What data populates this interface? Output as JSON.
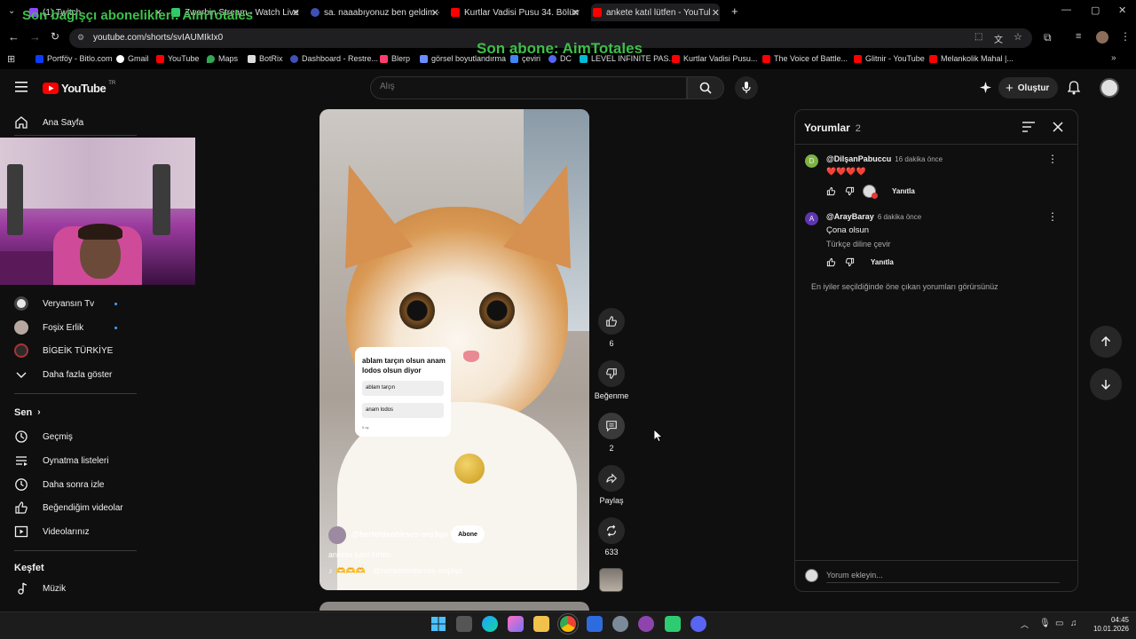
{
  "browser": {
    "tabs": [
      {
        "title": "(1) Twitch",
        "color": "#9146ff"
      },
      {
        "title": "Zwerbin Stream - Watch Live o",
        "color": "#2ecc71"
      },
      {
        "title": "sa. naaabıyonuz ben geldim - R",
        "color": "#3f51b5"
      },
      {
        "title": "Kurtlar Vadisi Pusu 34. Bölüm F",
        "color": "#ff0000"
      },
      {
        "title": "ankete katıl lütfen - YouTul",
        "color": "#ff0000"
      }
    ],
    "url": "youtube.com/shorts/svIAUMIkIx0",
    "bookmarks": [
      "Portföy - Bitlo.com",
      "Gmail",
      "YouTube",
      "Maps",
      "BotRix",
      "Dashboard - Restre...",
      "Blerp",
      "görsel boyutlandırma",
      "çeviri",
      "DC",
      "LEVEL INFINITE PAS...",
      "Kurtlar Vadisi Pusu...",
      "The Voice of Battle...",
      "Glitnir - YouTube",
      "Melankolik Mahal |..."
    ]
  },
  "overlays": {
    "donor_text": "Son bağışçı abonelikleri: AimTotales",
    "subscriber_text": "Son abone: AimTotales"
  },
  "header": {
    "logo_text": "YouTube",
    "logo_country": "TR",
    "search_placeholder": "Alış",
    "create_label": "Oluştur"
  },
  "sidebar": {
    "home_label": "Ana Sayfa",
    "subs": [
      {
        "label": "Veryansın Tv",
        "new": true
      },
      {
        "label": "Foşix Erlik",
        "new": true
      },
      {
        "label": "BİGEİK TÜRKİYE",
        "new": false
      }
    ],
    "show_more": "Daha fazla göster",
    "you_heading": "Sen",
    "you_items": [
      "Geçmiş",
      "Oynatma listeleri",
      "Daha sonra izle",
      "Beğendiğim videolar",
      "Videolarınız"
    ],
    "explore_heading": "Keşfet",
    "explore_items": [
      "Müzik"
    ]
  },
  "short": {
    "poll_question": "ablam tarçın olsun anam lodos olsun diyor",
    "poll_options": [
      "ablam tarçın",
      "anam lodos"
    ],
    "poll_votes": "0 oy",
    "channel": "@herteldenbirses-mq3qo",
    "subscribe_label": "Abone",
    "title": "anketa katıl lütfen",
    "music": "🫶🫶🫶 · @herteldenbirses-mq3qo"
  },
  "actions": {
    "likes": "6",
    "dislike_label": "Beğenme",
    "comments": "2",
    "share_label": "Paylaş",
    "remix": "633"
  },
  "comments": {
    "title": "Yorumlar",
    "count": "2",
    "items": [
      {
        "initial": "D",
        "avatar_color": "#7cb342",
        "author": "@DilşanPabuccu",
        "time": "16 dakika önce",
        "text": "❤️❤️❤️❤️",
        "translate": "",
        "reply": "Yanıtla"
      },
      {
        "initial": "A",
        "avatar_color": "#5e35b1",
        "author": "@ArayBaray",
        "time": "6 dakika önce",
        "text": "Çona olsun",
        "translate": "Türkçe diline çevir",
        "reply": "Yanıtla"
      }
    ],
    "footer_note": "En iyiler seçildiğinde öne çıkan yorumları görürsünüz",
    "add_placeholder": "Yorum ekleyin..."
  },
  "taskbar": {
    "time": "04:45",
    "date": "10.01.2026"
  }
}
